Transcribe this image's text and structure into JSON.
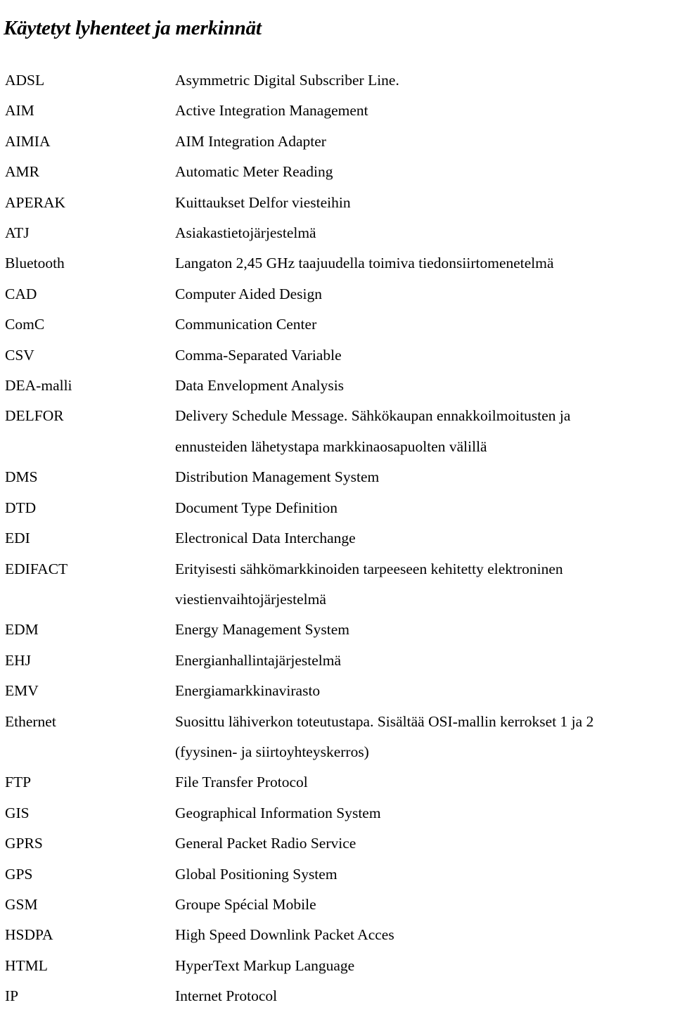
{
  "document": {
    "title": "Käytetyt lyhenteet ja merkinnät"
  },
  "glossary": {
    "entries": [
      {
        "term": "ADSL",
        "lines": [
          "Asymmetric Digital Subscriber Line."
        ]
      },
      {
        "term": "AIM",
        "lines": [
          "Active Integration Management"
        ]
      },
      {
        "term": "AIMIA",
        "lines": [
          "AIM Integration Adapter"
        ]
      },
      {
        "term": "AMR",
        "lines": [
          "Automatic Meter Reading"
        ]
      },
      {
        "term": "APERAK",
        "lines": [
          "Kuittaukset Delfor viesteihin"
        ]
      },
      {
        "term": "ATJ",
        "lines": [
          "Asiakastietojärjestelmä"
        ]
      },
      {
        "term": "Bluetooth",
        "lines": [
          "Langaton 2,45 GHz taajuudella toimiva tiedonsiirtomenetelmä"
        ]
      },
      {
        "term": "CAD",
        "lines": [
          "Computer Aided Design"
        ]
      },
      {
        "term": "ComC",
        "lines": [
          "Communication Center"
        ]
      },
      {
        "term": "CSV",
        "lines": [
          "Comma-Separated Variable"
        ]
      },
      {
        "term": "DEA-malli",
        "lines": [
          "Data Envelopment Analysis"
        ]
      },
      {
        "term": "DELFOR",
        "lines": [
          "Delivery Schedule Message. Sähkökaupan ennakkoilmoitusten ja",
          "ennusteiden lähetystapa markkinaosapuolten välillä"
        ]
      },
      {
        "term": "DMS",
        "lines": [
          "Distribution Management System"
        ]
      },
      {
        "term": "DTD",
        "lines": [
          "Document Type Definition"
        ]
      },
      {
        "term": "EDI",
        "lines": [
          "Electronical Data Interchange"
        ]
      },
      {
        "term": "EDIFACT",
        "lines": [
          "Erityisesti sähkömarkkinoiden tarpeeseen kehitetty elektroninen",
          "viestienvaihtojärjestelmä"
        ]
      },
      {
        "term": "EDM",
        "lines": [
          "Energy Management System"
        ]
      },
      {
        "term": "EHJ",
        "lines": [
          "Energianhallintajärjestelmä"
        ]
      },
      {
        "term": "EMV",
        "lines": [
          "Energiamarkkinavirasto"
        ]
      },
      {
        "term": "Ethernet",
        "lines": [
          "Suosittu lähiverkon toteutustapa. Sisältää OSI-mallin kerrokset 1 ja 2",
          "(fyysinen- ja siirtoyhteyskerros)"
        ]
      },
      {
        "term": "FTP",
        "lines": [
          "File Transfer Protocol"
        ]
      },
      {
        "term": "GIS",
        "lines": [
          "Geographical Information System"
        ]
      },
      {
        "term": "GPRS",
        "lines": [
          "General Packet Radio Service"
        ]
      },
      {
        "term": "GPS",
        "lines": [
          "Global Positioning System"
        ]
      },
      {
        "term": "GSM",
        "lines": [
          "Groupe Spécial Mobile"
        ]
      },
      {
        "term": "HSDPA",
        "lines": [
          "High Speed Downlink Packet Acces"
        ]
      },
      {
        "term": "HTML",
        "lines": [
          "HyperText Markup Language"
        ]
      },
      {
        "term": "IP",
        "lines": [
          "Internet Protocol"
        ]
      }
    ]
  }
}
